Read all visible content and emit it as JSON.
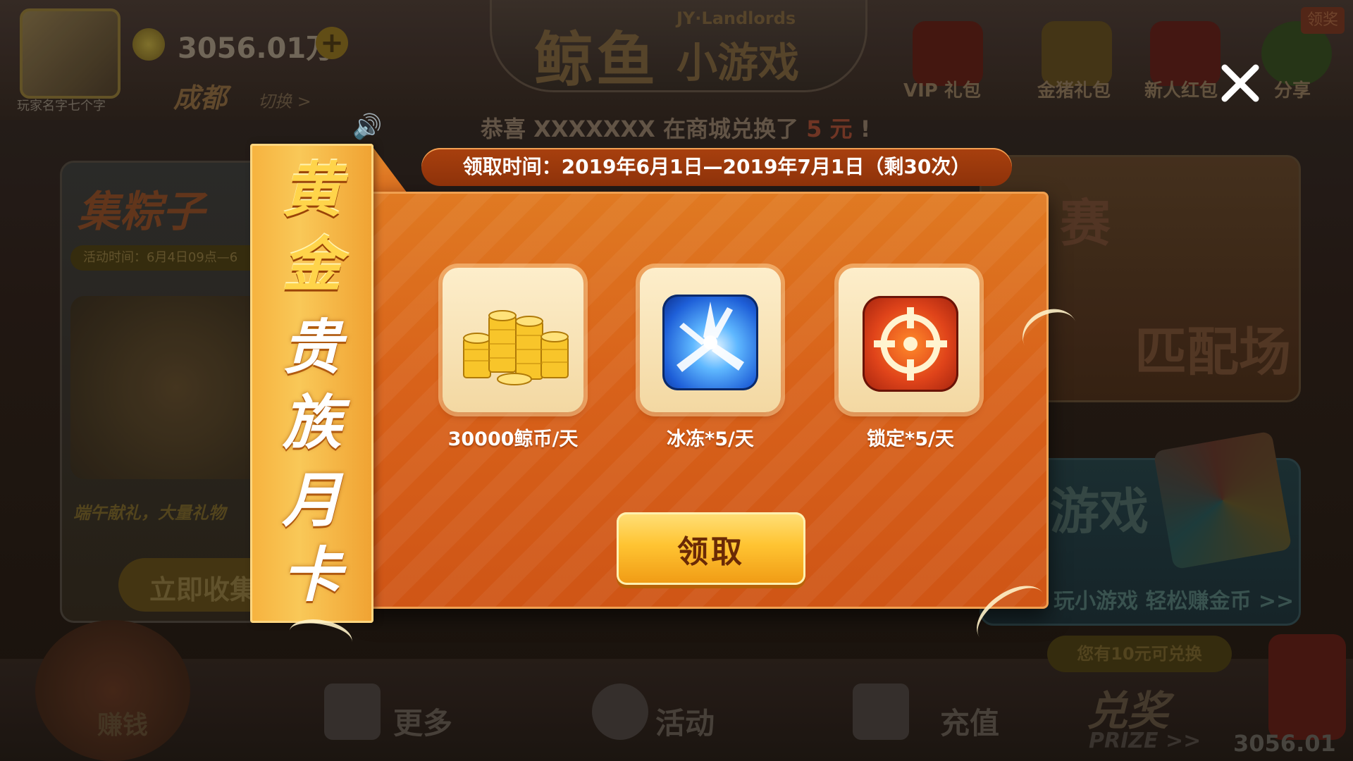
{
  "header": {
    "player_name": "玩家名字七个字",
    "coin_amount": "3056.01万",
    "city": "成都",
    "switch_city": "切换 >",
    "logo_main": "鲸鱼",
    "logo_sub": "小游戏",
    "logo_en": "JY·Landlords",
    "nav": [
      {
        "label": "VIP 礼包",
        "icon": "crown-icon"
      },
      {
        "label": "金猪礼包",
        "icon": "gold-pig-icon"
      },
      {
        "label": "新人红包",
        "icon": "red-envelope-icon"
      },
      {
        "label": "分享",
        "icon": "wechat-icon"
      }
    ],
    "claim_badge": "领奖"
  },
  "marquee": {
    "prefix": "恭喜 XXXXXXX 在商城兑换了 ",
    "highlight": "5 元",
    "suffix": " !"
  },
  "lobby": {
    "left_card": {
      "title": "集粽子",
      "time": "活动时间：6月4日09点—6",
      "caption": "端午献礼，大量礼物",
      "button": "立即收集"
    },
    "right_top": {
      "title": "赛",
      "label": "匹配场"
    },
    "right_bottom": {
      "title": "游戏",
      "subtitle": "玩小游戏 轻松赚金币 >>"
    }
  },
  "bottom_bar": {
    "mascot_label": "赚钱",
    "items": [
      {
        "label": "更多",
        "icon": "grid-icon"
      },
      {
        "label": "活动",
        "icon": "activity-icon"
      },
      {
        "label": "充值",
        "icon": "cart-icon"
      }
    ],
    "prize_pill": "您有10元可兑换",
    "prize_title": "兑奖",
    "prize_en": "PRIZE >>",
    "prize_coins": "3056.01"
  },
  "dialog": {
    "side_title": [
      "黄",
      "金",
      "贵",
      "族",
      "月",
      "卡"
    ],
    "time_range": "领取时间：2019年6月1日—2019年7月1日（剩30次）",
    "rewards": [
      {
        "label": "30000鲸币/天",
        "icon": "gold-coins-icon"
      },
      {
        "label": "冰冻*5/天",
        "icon": "ice-crystal-icon"
      },
      {
        "label": "锁定*5/天",
        "icon": "crosshair-icon"
      }
    ],
    "claim_button": "领取",
    "close_icon": "close-icon",
    "colors": {
      "panel": "#d8621a",
      "time_bar": "#9a380c",
      "button": "#ffc432",
      "side": "#f6b23e"
    }
  }
}
